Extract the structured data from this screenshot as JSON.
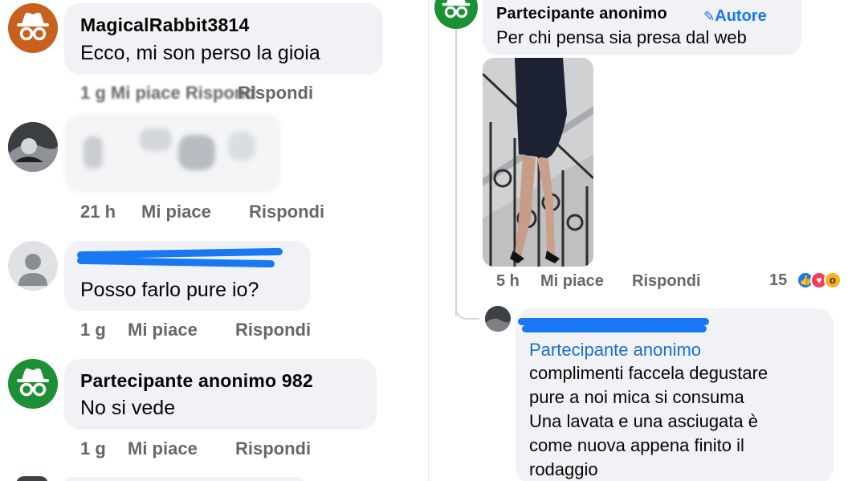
{
  "left_column": {
    "comments": [
      {
        "author": "MagicalRabbit3814",
        "text": "Ecco, mi son perso la gioia",
        "meta_blurred": "1 g Mi piace Rispondi",
        "meta_reply": "Rispondi"
      },
      {
        "time": "21 h",
        "like": "Mi piace",
        "reply": "Rispondi"
      },
      {
        "text": "Posso farlo pure io?",
        "time": "1 g",
        "like": "Mi piace",
        "reply": "Rispondi"
      },
      {
        "author": "Partecipante anonimo 982",
        "text": "No si vede",
        "time": "1 g",
        "like": "Mi piace",
        "reply": "Rispondi"
      }
    ]
  },
  "right_column": {
    "post": {
      "author": "Partecipante anonimo",
      "author_badge": "Autore",
      "text": "Per chi pensa sia presa dal web",
      "time": "5 h",
      "like": "Mi piace",
      "reply": "Rispondi",
      "reaction_count": "15"
    },
    "reply": {
      "mention": "Partecipante anonimo",
      "lines": [
        "complimenti faccela degustare",
        "pure a noi mica si consuma",
        "Una lavata e una asciugata è",
        "come nuova appena finito il",
        "rodaggio"
      ]
    }
  },
  "colors": {
    "bubble_bg": "#f0f2f5",
    "meta_text": "#65676b",
    "link_blue": "#1877f2",
    "anon_orange": "#c7611d",
    "anon_green": "#1d8f34"
  }
}
